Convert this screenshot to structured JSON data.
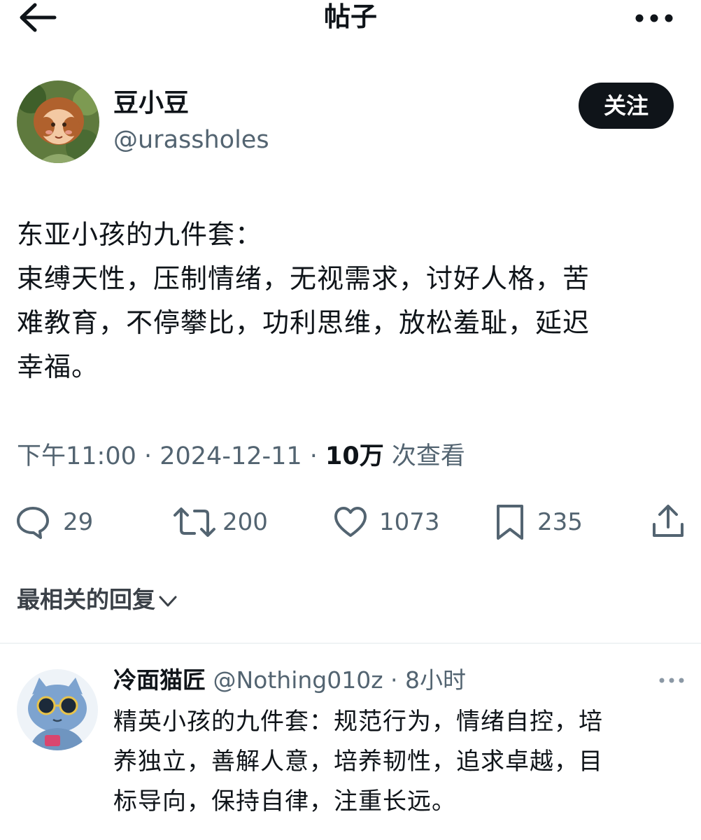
{
  "header": {
    "title": "帖子",
    "back_icon": "arrow-left-icon",
    "more_icon": "more-horizontal-icon"
  },
  "post": {
    "author_name": "豆小豆",
    "author_handle": "@urassholes",
    "follow_label": "关注",
    "body_lines": [
      "东亚小孩的九件套：",
      "束缚天性，压制情绪，无视需求，讨好人格，苦",
      "难教育，不停攀比，功利思维，放松羞耻，延迟",
      "幸福。"
    ],
    "time": "下午11:00 · 2024-12-11 · ",
    "views_count": "10万",
    "views_label": " 次查看",
    "actions": {
      "replies": "29",
      "retweets": "200",
      "likes": "1073",
      "bookmarks": "235"
    }
  },
  "replies_section": {
    "sort_label": "最相关的回复"
  },
  "reply": {
    "author_name": "冷面猫匠",
    "handle_time": " @Nothing010z · 8小时",
    "body_lines": [
      "精英小孩的九件套：规范行为，情绪自控，培",
      "养独立，善解人意，培养韧性，追求卓越，目",
      "标导向，保持自律，注重长远。"
    ]
  },
  "colors": {
    "text_primary": "#0f1419",
    "text_secondary": "#536471",
    "button_bg": "#0f1419",
    "divider": "#eff3f4"
  }
}
